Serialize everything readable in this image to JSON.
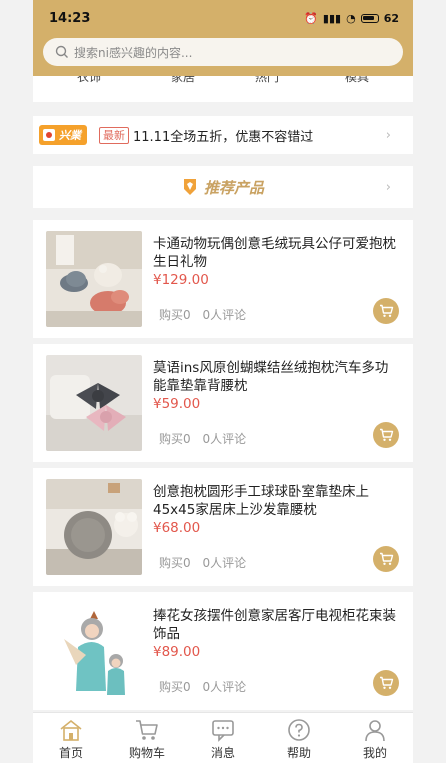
{
  "status": {
    "time": "14:23",
    "battery": "62"
  },
  "search": {
    "placeholder": "搜索ni感兴趣的内容..."
  },
  "categories": [
    "衣饰",
    "家居",
    "热门",
    "模具"
  ],
  "promo": {
    "logo": "兴業",
    "badge": "最新",
    "text": "11.11全场五折，优惠不容错过"
  },
  "recommend": {
    "title": "推荐产品"
  },
  "products": [
    {
      "title": "卡通动物玩偶创意毛绒玩具公仔可爱抱枕生日礼物",
      "price": "¥129.00",
      "sales": "购买0",
      "reviews": "0人评论"
    },
    {
      "title": "莫语ins风原创蝴蝶结丝绒抱枕汽车多功能靠垫靠背腰枕",
      "price": "¥59.00",
      "sales": "购买0",
      "reviews": "0人评论"
    },
    {
      "title": "创意抱枕圆形手工球球卧室靠垫床上45x45家居床上沙发靠腰枕",
      "price": "¥68.00",
      "sales": "购买0",
      "reviews": "0人评论"
    },
    {
      "title": "捧花女孩摆件创意家居客厅电视柜花束装饰品",
      "price": "¥89.00",
      "sales": "购买0",
      "reviews": "0人评论"
    }
  ],
  "tabs": [
    {
      "label": "首页",
      "icon": "home-icon",
      "active": true
    },
    {
      "label": "购物车",
      "icon": "cart-icon"
    },
    {
      "label": "消息",
      "icon": "message-icon"
    },
    {
      "label": "帮助",
      "icon": "help-icon"
    },
    {
      "label": "我的",
      "icon": "user-icon"
    }
  ],
  "colors": {
    "accent": "#d4b06a",
    "price": "#e2574c",
    "recommend": "#c9a262"
  }
}
